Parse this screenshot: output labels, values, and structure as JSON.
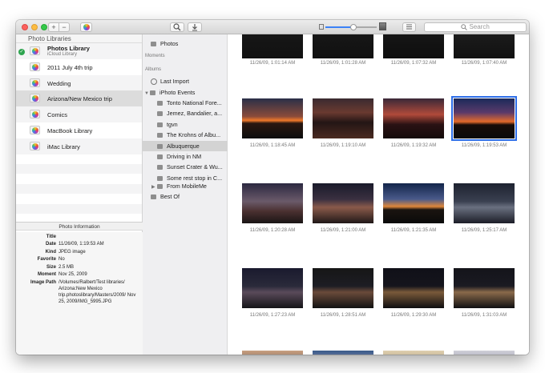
{
  "toolbar": {
    "plus_label": "+",
    "minus_label": "−",
    "search_placeholder": "Search",
    "zoom_level": 0.55
  },
  "library": {
    "header": "Photo Libraries",
    "items": [
      {
        "name": "Photos Library",
        "sub": "iCloud Library",
        "checked": true
      },
      {
        "name": "2011 July 4th trip"
      },
      {
        "name": "Wedding"
      },
      {
        "name": "Arizona/New Mexico trip"
      },
      {
        "name": "Comics"
      },
      {
        "name": "MacBook Library"
      },
      {
        "name": "iMac Library"
      }
    ]
  },
  "info": {
    "header": "Photo Information",
    "rows": [
      {
        "k": "Title",
        "v": ""
      },
      {
        "k": "Date",
        "v": "11/26/09, 1:19:53 AM"
      },
      {
        "k": "Kind",
        "v": "JPEG image"
      },
      {
        "k": "Favorite",
        "v": "No"
      },
      {
        "k": "Size",
        "v": "2.5 MB"
      },
      {
        "k": "Moment",
        "v": "Nov 25, 2009"
      },
      {
        "k": "Image Path",
        "v": "/Volumes/Ralbert/Test libraries/ Arizona:New Mexico trip.photoslibrary/Masters/2009/ Nov 25, 2009/IMG_5995.JPG"
      }
    ]
  },
  "sources": {
    "photos": "Photos",
    "moments": "Moments",
    "albums": "Albums",
    "last_import": "Last Import",
    "iphoto_events": "iPhoto Events",
    "events": [
      "Tonto National Fore...",
      "Jemez, Bandalier, a...",
      "tgvn",
      "The Krohns of Albu...",
      "Albuquerque",
      "Driving in NM",
      "Sunset Crater & Wu...",
      "Some rest stop in C..."
    ],
    "from_mobileme": "From MobileMe",
    "best_of": "Best Of"
  },
  "grid": {
    "captions": [
      "11/26/09, 1:01:14 AM",
      "11/26/09, 1:01:28 AM",
      "11/26/09, 1:07:32 AM",
      "11/26/09, 1:07:40 AM",
      "11/26/09, 1:18:45 AM",
      "11/26/09, 1:19:10 AM",
      "11/26/09, 1:19:32 AM",
      "11/26/09, 1:19:53 AM",
      "11/26/09, 1:20:28 AM",
      "11/26/09, 1:21:00 AM",
      "11/26/09, 1:21:35 AM",
      "11/26/09, 1:25:17 AM",
      "11/26/09, 1:27:23 AM",
      "11/26/09, 1:28:51 AM",
      "11/26/09, 1:29:30 AM",
      "11/26/09, 1:31:03 AM"
    ]
  }
}
